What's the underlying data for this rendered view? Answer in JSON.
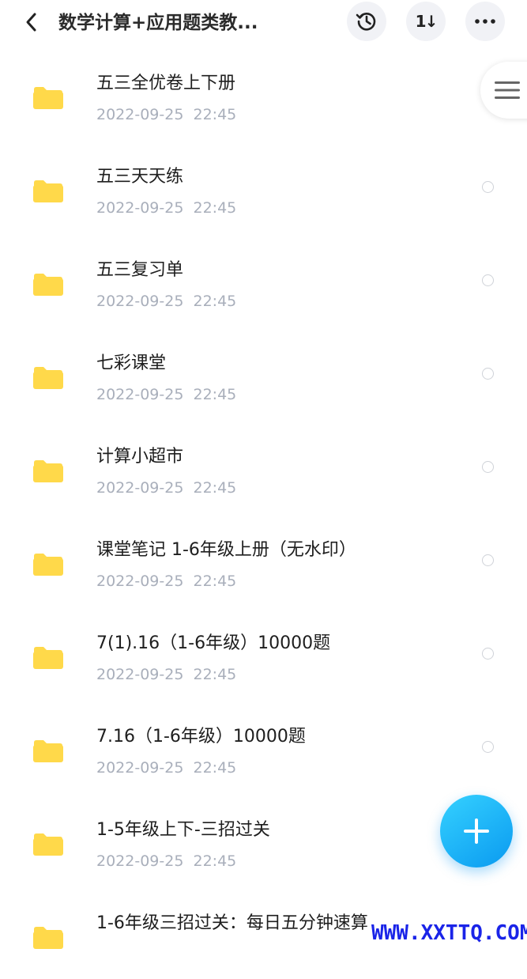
{
  "header": {
    "title": "数学计算+应用题类教...",
    "back_icon": "back-arrow-icon",
    "history_icon": "history-clock-icon",
    "sort_label": "1↓",
    "more_icon": "more-dots-icon"
  },
  "files": [
    {
      "name": "五三全优卷上下册",
      "date": "2022-09-25  22:45"
    },
    {
      "name": "五三天天练",
      "date": "2022-09-25  22:45"
    },
    {
      "name": "五三复习单",
      "date": "2022-09-25  22:45"
    },
    {
      "name": "七彩课堂",
      "date": "2022-09-25  22:45"
    },
    {
      "name": "计算小超市",
      "date": "2022-09-25  22:45"
    },
    {
      "name": "课堂笔记 1-6年级上册（无水印）",
      "date": "2022-09-25  22:45"
    },
    {
      "name": "7(1).16（1-6年级）10000题",
      "date": "2022-09-25  22:45"
    },
    {
      "name": "7.16（1-6年级）10000题",
      "date": "2022-09-25  22:45"
    },
    {
      "name": "1-5年级上下-三招过关",
      "date": "2022-09-25  22:45"
    },
    {
      "name": "1-6年级三招过关：每日五分钟速算",
      "date": ""
    }
  ],
  "watermark": "WWW.XXTTQ.COM",
  "colors": {
    "folder": "#ffd94a",
    "accent": "#12a8f7",
    "date_text": "#a9afbb"
  }
}
